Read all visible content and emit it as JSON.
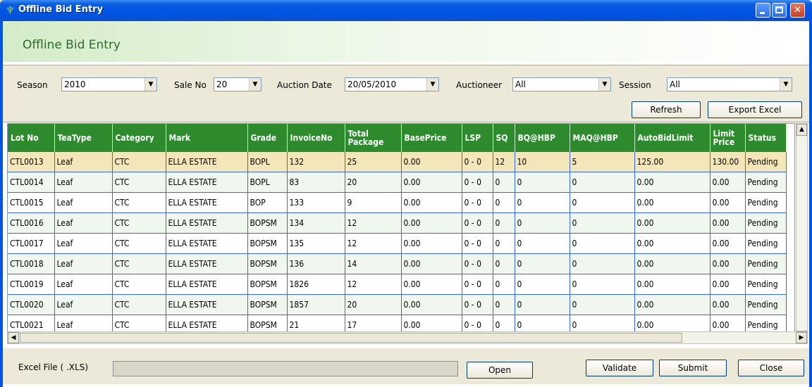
{
  "window": {
    "title": "Offline Bid Entry",
    "icon": "tea-leaf-icon",
    "controls": {
      "minimize": "minimize-icon",
      "maximize": "maximize-icon",
      "close": "✕"
    }
  },
  "header": {
    "title": "Offline Bid Entry"
  },
  "filters": {
    "season": {
      "label": "Season",
      "value": "2010"
    },
    "sale_no": {
      "label": "Sale No",
      "value": "20"
    },
    "auction_date": {
      "label": "Auction Date",
      "value": "20/05/2010"
    },
    "auctioneer": {
      "label": "Auctioneer",
      "value": "All"
    },
    "session": {
      "label": "Session",
      "value": "All"
    },
    "refresh_label": "Refresh",
    "export_label": "Export Excel"
  },
  "grid": {
    "columns": [
      "Lot No",
      "TeaType",
      "Category",
      "Mark",
      "Grade",
      "InvoiceNo",
      "Total Package",
      "BasePrice",
      "LSP",
      "SQ",
      "BQ@HBP",
      "MAQ@HBP",
      "AutoBidLimit",
      "Limit Price",
      "Status"
    ],
    "rows": [
      [
        "CTL0013",
        "Leaf",
        "CTC",
        "ELLA ESTATE",
        "BOPL",
        "132",
        "25",
        "0.00",
        "0 - 0",
        "12",
        "10",
        "5",
        "125.00",
        "130.00",
        "Pending"
      ],
      [
        "CTL0014",
        "Leaf",
        "CTC",
        "ELLA ESTATE",
        "BOPL",
        "83",
        "20",
        "0.00",
        "0 - 0",
        "0",
        "0",
        "0",
        "0.00",
        "0.00",
        "Pending"
      ],
      [
        "CTL0015",
        "Leaf",
        "CTC",
        "ELLA ESTATE",
        "BOP",
        "133",
        "9",
        "0.00",
        "0 - 0",
        "0",
        "0",
        "0",
        "0.00",
        "0.00",
        "Pending"
      ],
      [
        "CTL0016",
        "Leaf",
        "CTC",
        "ELLA ESTATE",
        "BOPSM",
        "134",
        "12",
        "0.00",
        "0 - 0",
        "0",
        "0",
        "0",
        "0.00",
        "0.00",
        "Pending"
      ],
      [
        "CTL0017",
        "Leaf",
        "CTC",
        "ELLA ESTATE",
        "BOPSM",
        "135",
        "12",
        "0.00",
        "0 - 0",
        "0",
        "0",
        "0",
        "0.00",
        "0.00",
        "Pending"
      ],
      [
        "CTL0018",
        "Leaf",
        "CTC",
        "ELLA ESTATE",
        "BOPSM",
        "136",
        "14",
        "0.00",
        "0 - 0",
        "0",
        "0",
        "0",
        "0.00",
        "0.00",
        "Pending"
      ],
      [
        "CTL0019",
        "Leaf",
        "CTC",
        "ELLA ESTATE",
        "BOPSM",
        "1826",
        "12",
        "0.00",
        "0 - 0",
        "0",
        "0",
        "0",
        "0.00",
        "0.00",
        "Pending"
      ],
      [
        "CTL0020",
        "Leaf",
        "CTC",
        "ELLA ESTATE",
        "BOPSM",
        "1857",
        "20",
        "0.00",
        "0 - 0",
        "0",
        "0",
        "0",
        "0.00",
        "0.00",
        "Pending"
      ],
      [
        "CTL0021",
        "Leaf",
        "CTC",
        "ELLA ESTATE",
        "BOPSM",
        "21",
        "17",
        "0.00",
        "0 - 0",
        "0",
        "0",
        "0",
        "0.00",
        "0.00",
        "Pending"
      ]
    ]
  },
  "bottom": {
    "excel_label": "Excel File ( .XLS)",
    "excel_value": "",
    "open_label": "Open",
    "validate_label": "Validate",
    "submit_label": "Submit",
    "close_label": "Close"
  },
  "colors": {
    "header_green": "#2d8a2d",
    "selected_row": "#f3e6b8",
    "title_blue": "#0054e3"
  }
}
